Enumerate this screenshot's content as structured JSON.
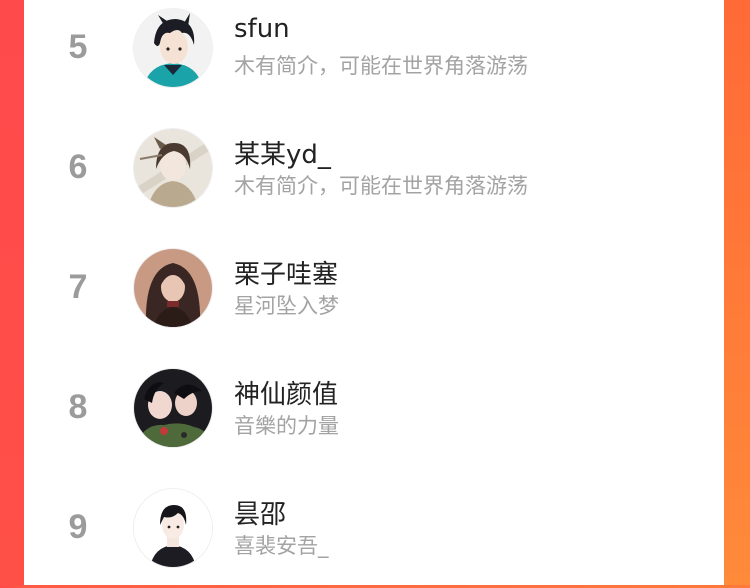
{
  "colors": {
    "accent_left": "#ff4a4c",
    "accent_right": "#ff7a3a",
    "rank_text": "#9b9b9b",
    "name_text": "#222222",
    "bio_text": "#a3a3a3"
  },
  "ranking": {
    "items": [
      {
        "rank": "5",
        "name": "sfun",
        "bio": "木有简介，可能在世界角落游荡",
        "avatar_icon": "anime-boy-teal-jacket-avatar"
      },
      {
        "rank": "6",
        "name": "某某yd_",
        "bio": "木有简介，可能在世界角落游荡",
        "avatar_icon": "ancient-style-illustration-avatar"
      },
      {
        "rank": "7",
        "name": "栗子哇塞",
        "bio": "星河坠入梦",
        "avatar_icon": "girl-portrait-avatar"
      },
      {
        "rank": "8",
        "name": "神仙颜值",
        "bio": "音樂的力量",
        "avatar_icon": "anime-couple-dark-avatar"
      },
      {
        "rank": "9",
        "name": "昙邵",
        "bio": "喜裴安吾_",
        "avatar_icon": "anime-boy-black-turtleneck-avatar"
      }
    ]
  }
}
